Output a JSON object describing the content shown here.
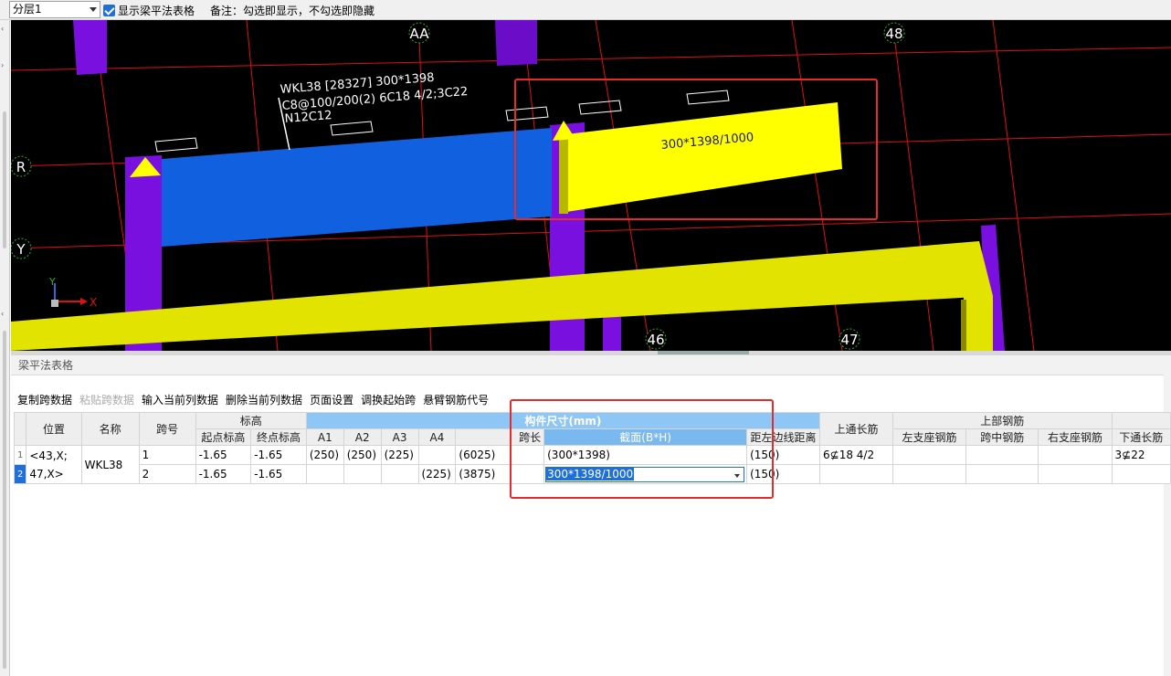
{
  "topbar": {
    "floor_value": "分层1",
    "show_table_label": "显示梁平法表格",
    "note": "备注：勾选即显示，不勾选即隐藏"
  },
  "viewport": {
    "axis_labels": [
      "AA",
      "48",
      "R",
      "Y",
      "46",
      "47"
    ],
    "coord_x": "X",
    "coord_y": "Y",
    "beam_annotation": [
      "WKL38 [28327] 300*1398",
      "C8@100/200(2) 6C18 4/2;3C22",
      "N12C12"
    ],
    "section_label": "300*1398/1000"
  },
  "panel": {
    "title": "梁平法表格",
    "toolbar": [
      "复制跨数据",
      "粘贴跨数据",
      "输入当前列数据",
      "删除当前列数据",
      "页面设置",
      "调换起始跨",
      "悬臂钢筋代号"
    ]
  },
  "table": {
    "header_group": {
      "elev": "标高",
      "size": "构件尺寸(mm)",
      "top_rebar": "上部钢筋"
    },
    "headers": {
      "position": "位置",
      "name": "名称",
      "span_no": "跨号",
      "start_elev": "起点标高",
      "end_elev": "终点标高",
      "a1": "A1",
      "a2": "A2",
      "a3": "A3",
      "a4": "A4",
      "span_len": "跨长",
      "section": "截面(B*H)",
      "offset": "距左边线距离",
      "top_long": "上通长筋",
      "left_seat": "左支座钢筋",
      "mid": "跨中钢筋",
      "right_seat": "右支座钢筋",
      "bottom_long": "下通长筋"
    },
    "position": "<43,X;47,X>",
    "position_l1": "<43,X;",
    "position_l2": "47,X>",
    "name": "WKL38",
    "rows": [
      {
        "num": "1",
        "span_no": "1",
        "start_elev": "-1.65",
        "end_elev": "-1.65",
        "a1": "(250)",
        "a2": "(250)",
        "a3": "(225)",
        "a4": "",
        "span_len": "(6025)",
        "section": "(300*1398)",
        "offset": "(150)",
        "top_long": "6⊈18 4/2",
        "bottom_long": "3⊈22"
      },
      {
        "num": "2",
        "span_no": "2",
        "start_elev": "-1.65",
        "end_elev": "-1.65",
        "a1": "",
        "a2": "",
        "a3": "",
        "a4": "(225)",
        "span_len": "(3875)",
        "section": "300*1398/1000",
        "offset": "(150)",
        "top_long": "",
        "bottom_long": ""
      }
    ]
  },
  "colors": {
    "beam_blue": "#1060e0",
    "beam_yellow": "#ffff00",
    "column_purple": "#7a10e0",
    "highlight_red": "#e52b2b",
    "grid_red": "#e01010",
    "header_blue": "#8ec6f5"
  }
}
